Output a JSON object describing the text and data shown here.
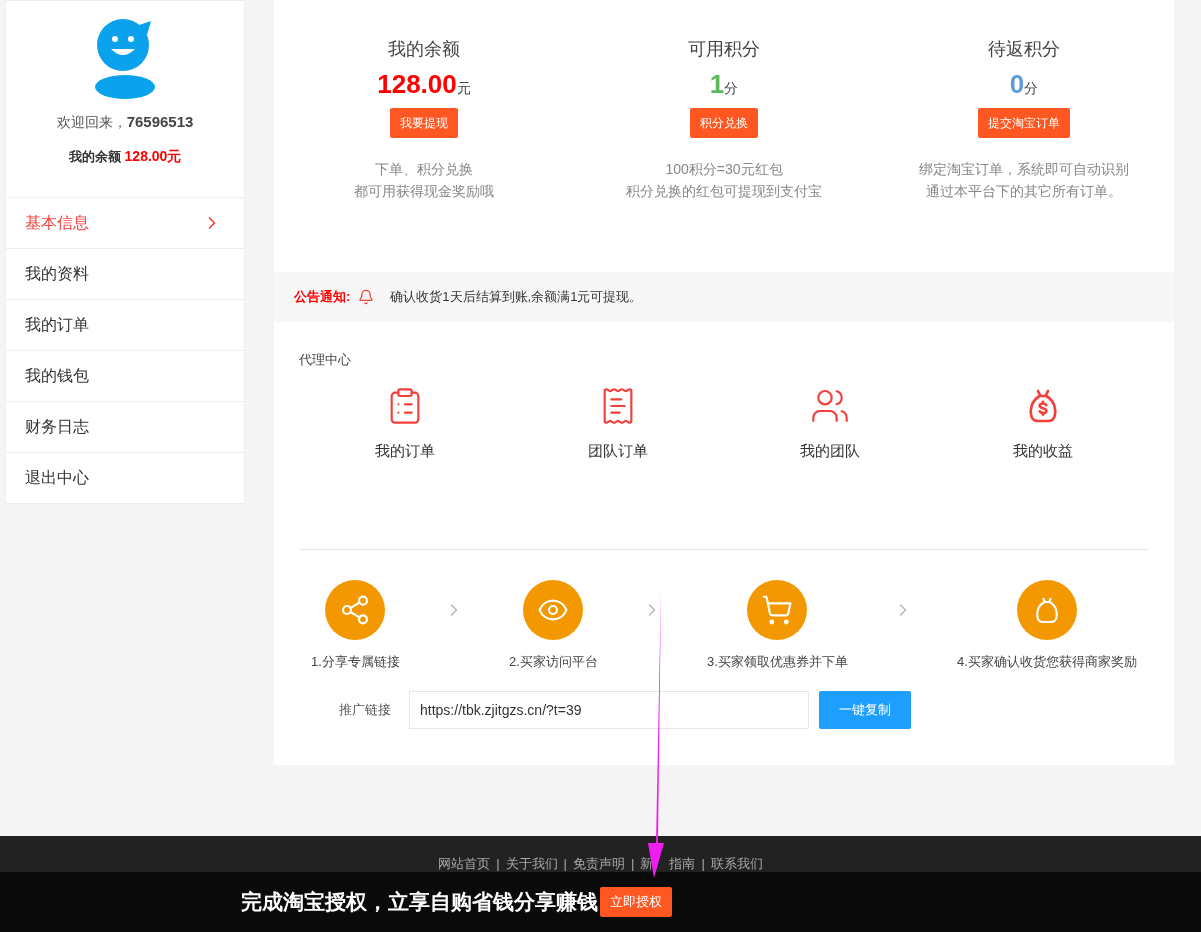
{
  "sidebar": {
    "welcome_label": "欢迎回来，",
    "username": "76596513",
    "balance_label": "我的余额",
    "balance_value": "128.00元",
    "items": [
      {
        "label": "基本信息",
        "selected": true
      },
      {
        "label": "我的资料",
        "selected": false
      },
      {
        "label": "我的订单",
        "selected": false
      },
      {
        "label": "我的钱包",
        "selected": false
      },
      {
        "label": "财务日志",
        "selected": false
      },
      {
        "label": "退出中心",
        "selected": false
      }
    ]
  },
  "stats": [
    {
      "title": "我的余额",
      "value": "128.00",
      "unit": "元",
      "color": "#ff0000",
      "button": "我要提现",
      "description": [
        "下单、积分兑换",
        "都可用获得现金奖励哦"
      ]
    },
    {
      "title": "可用积分",
      "value": "1",
      "unit": "分",
      "color": "#5cb85c",
      "button": "积分兑换",
      "description": [
        "100积分=30元红包",
        "积分兑换的红包可提现到支付宝"
      ]
    },
    {
      "title": "待返积分",
      "value": "0",
      "unit": "分",
      "color": "#5b9bdf",
      "button": "提交淘宝订单",
      "description": [
        "绑定淘宝订单，系统即可自动识别",
        "通过本平台下的其它所有订单。"
      ]
    }
  ],
  "notice": {
    "label": "公告通知:",
    "text": "确认收货1天后结算到账,余额满1元可提现。"
  },
  "agent_center": {
    "title": "代理中心",
    "items": [
      {
        "kind": "clipboard",
        "label": "我的订单"
      },
      {
        "kind": "receipt",
        "label": "团队订单"
      },
      {
        "kind": "people",
        "label": "我的团队"
      },
      {
        "kind": "moneybag",
        "label": "我的收益"
      }
    ],
    "steps": [
      {
        "kind": "share",
        "label": "1.分享专属链接"
      },
      {
        "kind": "eye",
        "label": "2.买家访问平台"
      },
      {
        "kind": "cart",
        "label": "3.买家领取优惠券并下单"
      },
      {
        "kind": "moneybag",
        "label": "4.买家确认收货您获得商家奖励"
      }
    ],
    "link_label": "推广链接",
    "link_value": "https://tbk.zjitgzs.cn/?t=39",
    "copy_button": "一键复制"
  },
  "footer": {
    "separator": "|",
    "links": [
      [
        "网站首页"
      ],
      [
        "关于我们"
      ],
      [
        "免责声明"
      ],
      [
        "新",
        "指南"
      ],
      [
        "联系我们"
      ]
    ],
    "banner": {
      "text": "完成淘宝授权，立享自购省钱分享赚钱",
      "button": "立即授权"
    }
  }
}
